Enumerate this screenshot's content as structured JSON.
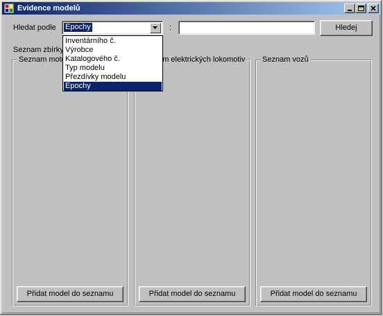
{
  "window": {
    "title": "Evidence modelů",
    "controls": [
      "minimize-icon",
      "maximize-icon",
      "close-icon"
    ]
  },
  "search": {
    "label": "Hledat podle",
    "selected": "Epochy",
    "separator": ":",
    "query": "",
    "button_label": "Hledej",
    "options": [
      "Inventárního č.",
      "Výrobce",
      "Katalogového č.",
      "Typ modelu",
      "Přezdívky modelu",
      "Epochy"
    ]
  },
  "collection_label": "Seznam zbírky",
  "groups": [
    {
      "title": "Seznam motorových lokomotiv",
      "button_label": "Přidat model do seznamu"
    },
    {
      "title": "Seznam elektrických lokomotiv",
      "button_label": "Přidat model do seznamu"
    },
    {
      "title": "Seznam vozů",
      "button_label": "Přidat model do seznamu"
    }
  ],
  "colors": {
    "face": "#c0c0c0",
    "selection": "#0a246a",
    "title_start": "#0a246a",
    "title_end": "#a6caf0"
  }
}
